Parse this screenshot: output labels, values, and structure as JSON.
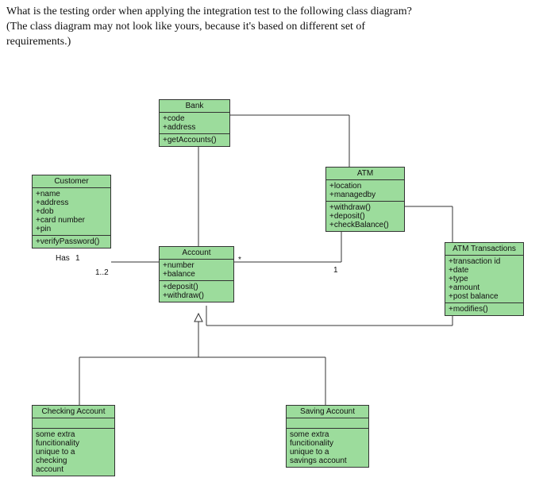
{
  "question": {
    "line1": "What is the testing order when applying the integration test to the following class diagram?",
    "line2": "(The class diagram may not look like yours, because it's based on different set of",
    "line3": "requirements.)"
  },
  "chart_data": {
    "type": "uml-class-diagram",
    "classes": [
      {
        "name": "Bank",
        "attributes": [
          "+code",
          "+address"
        ],
        "operations": [
          "+getAccounts()"
        ]
      },
      {
        "name": "Customer",
        "attributes": [
          "+name",
          "+address",
          "+dob",
          "+card number",
          "+pin"
        ],
        "operations": [
          "+verifyPassword()"
        ]
      },
      {
        "name": "Account",
        "attributes": [
          "+number",
          "+balance"
        ],
        "operations": [
          "+deposit()",
          "+withdraw()"
        ]
      },
      {
        "name": "ATM",
        "attributes": [
          "+location",
          "+managedby"
        ],
        "operations": [
          "+withdraw()",
          "+deposit()",
          "+checkBalance()"
        ]
      },
      {
        "name": "ATM Transactions",
        "attributes": [
          "+transaction id",
          "+date",
          "+type",
          "+amount",
          "+post balance"
        ],
        "operations": [
          "+modifies()"
        ]
      },
      {
        "name": "Checking Account",
        "attributes": [],
        "operations": [
          "some extra funcitionality unique to a checking account"
        ]
      },
      {
        "name": "Saving Account",
        "attributes": [],
        "operations": [
          "some extra funcitionality unique to a savings account"
        ]
      }
    ],
    "relationships": [
      {
        "from": "Bank",
        "to": "Account",
        "type": "aggregation"
      },
      {
        "from": "Customer",
        "to": "Account",
        "type": "association",
        "label": "Has",
        "multiplicity": {
          "customer": "1",
          "account": "1..2"
        }
      },
      {
        "from": "Bank",
        "to": "ATM",
        "type": "association"
      },
      {
        "from": "ATM",
        "to": "Account",
        "type": "association",
        "multiplicity": {
          "atm": "*",
          "account": "1"
        }
      },
      {
        "from": "ATM",
        "to": "ATM Transactions",
        "type": "association"
      },
      {
        "from": "ATM Transactions",
        "to": "Account",
        "type": "association"
      },
      {
        "from": "Checking Account",
        "to": "Account",
        "type": "generalization"
      },
      {
        "from": "Saving Account",
        "to": "Account",
        "type": "generalization"
      }
    ]
  },
  "labels": {
    "has": "Has",
    "m1": "1",
    "m12": "1..2",
    "mstar": "*"
  },
  "classes": {
    "bank": {
      "title": "Bank",
      "a0": "+code",
      "a1": "+address",
      "o0": "+getAccounts()"
    },
    "customer": {
      "title": "Customer",
      "a0": "+name",
      "a1": "+address",
      "a2": "+dob",
      "a3": "+card number",
      "a4": "+pin",
      "o0": "+verifyPassword()"
    },
    "account": {
      "title": "Account",
      "a0": "+number",
      "a1": "+balance",
      "o0": "+deposit()",
      "o1": "+withdraw()"
    },
    "atm": {
      "title": "ATM",
      "a0": "+location",
      "a1": "+managedby",
      "o0": "+withdraw()",
      "o1": "+deposit()",
      "o2": "+checkBalance()"
    },
    "atmtx": {
      "title": "ATM Transactions",
      "a0": "+transaction id",
      "a1": "+date",
      "a2": "+type",
      "a3": "+amount",
      "a4": "+post balance",
      "o0": "+modifies()"
    },
    "checking": {
      "title": "Checking Account",
      "o0": "some extra",
      "o1": "funcitionality",
      "o2": "unique to a",
      "o3": "checking",
      "o4": "account"
    },
    "saving": {
      "title": "Saving Account",
      "o0": "some extra",
      "o1": "funcitionality",
      "o2": "unique to a",
      "o3": "savings account"
    }
  }
}
